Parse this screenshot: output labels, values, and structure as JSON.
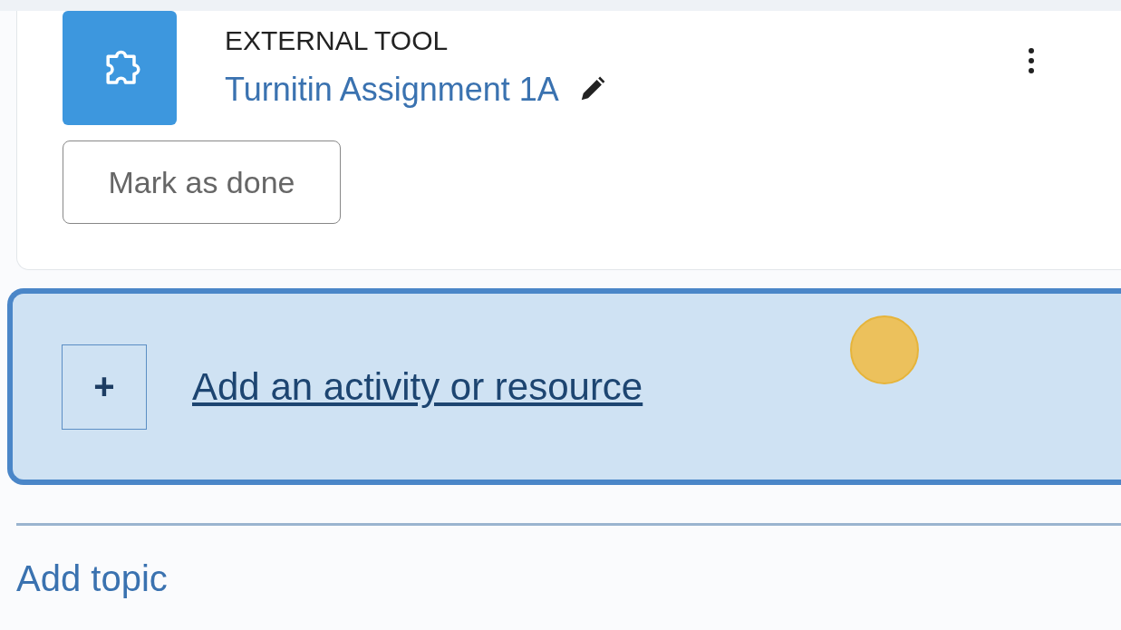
{
  "activity": {
    "type_label": "EXTERNAL TOOL",
    "title": "Turnitin Assignment 1A",
    "completion_button": "Mark as done"
  },
  "add_activity": {
    "icon_text": "+",
    "link": "Add an activity or resource",
    "focused": true
  },
  "add_topic": {
    "link": "Add topic"
  }
}
